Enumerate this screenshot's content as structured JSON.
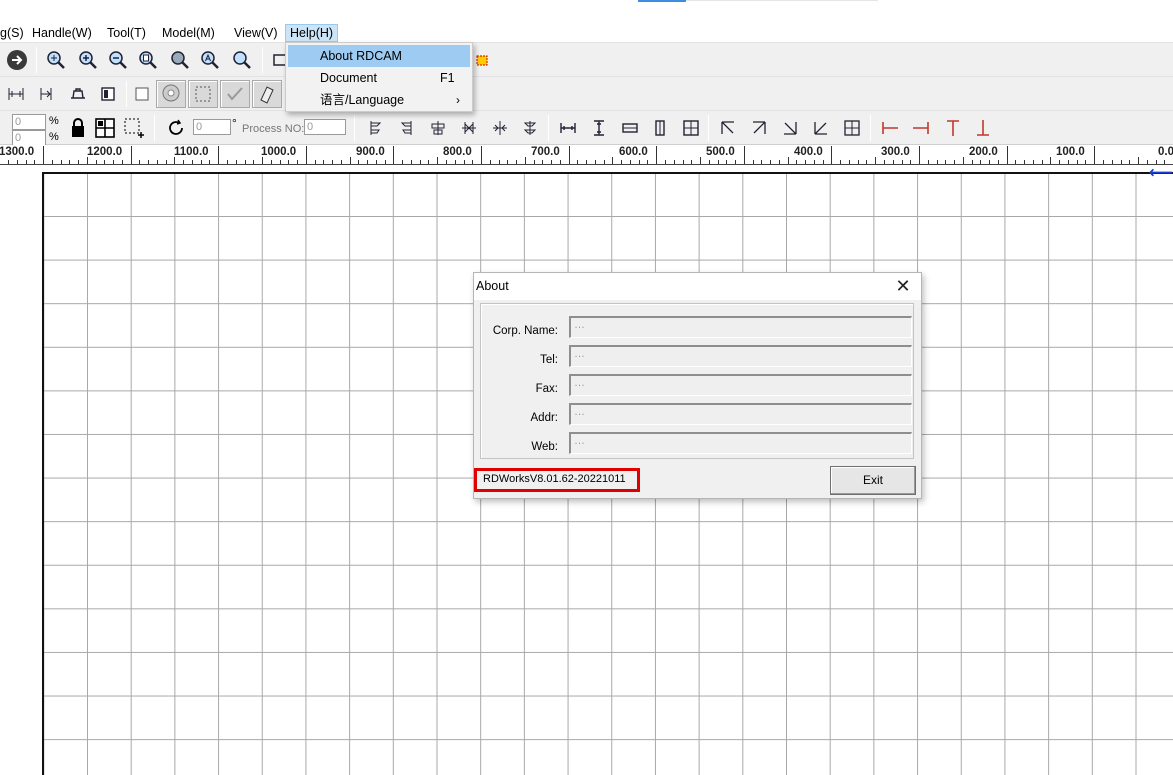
{
  "menubar": {
    "items": [
      {
        "label": "g(S)"
      },
      {
        "label": "Handle(W)"
      },
      {
        "label": "Tool(T)"
      },
      {
        "label": "Model(M)"
      },
      {
        "label": "View(V)"
      },
      {
        "label": "Help(H)"
      }
    ],
    "active": "Help(H)"
  },
  "help_menu": {
    "items": [
      {
        "label": "About RDCAM",
        "shortcut": "",
        "highlighted": true
      },
      {
        "label": "Document",
        "shortcut": "F1"
      },
      {
        "label": "语言/Language",
        "submenu_arrow": "›"
      }
    ]
  },
  "toolbar3": {
    "percent1": "%",
    "percent2": "%",
    "field1": "0",
    "field2": "0",
    "angle_value": "0",
    "degree": "°",
    "process_label": "Process NO:",
    "process_value": "0"
  },
  "ruler": {
    "labels": [
      "1300.0",
      "1200.0",
      "1100.0",
      "1000.0",
      "900.0",
      "800.0",
      "700.0",
      "600.0",
      "500.0",
      "400.0",
      "300.0",
      "200.0",
      "100.0",
      "0.0"
    ]
  },
  "about_dialog": {
    "title": "About",
    "fields": [
      {
        "label": "Corp. Name:",
        "value": "…"
      },
      {
        "label": "Tel:",
        "value": "…"
      },
      {
        "label": "Fax:",
        "value": "…"
      },
      {
        "label": "Addr:",
        "value": "…"
      },
      {
        "label": "Web:",
        "value": "…"
      }
    ],
    "version": "RDWorksV8.01.62-20221011",
    "exit_label": "Exit",
    "highlight_color": "#e00000"
  },
  "colors": {
    "menu_highlight": "#9ecbf2",
    "accent": "#3d8ee0",
    "arrow": "#1a3fd0"
  }
}
